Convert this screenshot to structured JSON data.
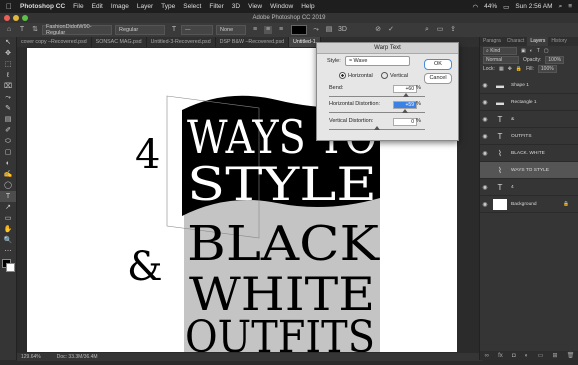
{
  "menubar": {
    "apple": "",
    "app": "Photoshop CC",
    "items": [
      "File",
      "Edit",
      "Image",
      "Layer",
      "Type",
      "Select",
      "Filter",
      "3D",
      "View",
      "Window",
      "Help"
    ],
    "status": {
      "battery": "44%",
      "time": "Sun 2:56 AM"
    }
  },
  "window": {
    "title": "Adobe Photoshop CC 2019"
  },
  "options": {
    "font_family": "FashionDidotW90-Regular",
    "font_style": "Regular",
    "font_size": "—",
    "aa": "None",
    "color": "#000000"
  },
  "tabs": [
    "cover copy –Recovered.psd",
    "SONSAC MAG.psd",
    "Untitled-3-Recovered.psd",
    "DSP B&W –Recovered.psd",
    "Untitled-1"
  ],
  "tools": [
    "↖",
    "✥",
    "⬚",
    "ℓ",
    "⌧",
    "⤳",
    "✎",
    "▤",
    "✐",
    "⬭",
    "▢",
    "◐",
    "✍",
    "◯",
    "T",
    "↗",
    "▭",
    "✋",
    "🔍",
    "⋯"
  ],
  "canvas": {
    "num": "4",
    "amp": "&",
    "line1": "WAYS TO",
    "line2": "STYLE",
    "line3": "BLACK",
    "line4": "WHITE",
    "line5": "OUTFITS"
  },
  "status": {
    "zoom": "129.64%",
    "doc": "Doc: 33.3M/36.4M"
  },
  "panel": {
    "tabs": [
      "Paragra",
      "Charact",
      "Layers",
      "History"
    ],
    "kind": "Kind",
    "mode": "Normal",
    "opacity_label": "Opacity:",
    "opacity": "100%",
    "lock_label": "Lock:",
    "fill_label": "Fill:",
    "fill": "100%",
    "layers": [
      {
        "name": "Shape 1",
        "thumb": "▬",
        "sel": false
      },
      {
        "name": "Rectangle 1",
        "thumb": "▬",
        "sel": false
      },
      {
        "name": "&",
        "thumb": "T",
        "sel": false
      },
      {
        "name": "OUTFITS",
        "thumb": "T",
        "sel": false
      },
      {
        "name": "BLACK. WHITE",
        "thumb": "⌇",
        "sel": false
      },
      {
        "name": "WAYS TO STYLE",
        "thumb": "⌇",
        "sel": true
      },
      {
        "name": "4",
        "thumb": "T",
        "sel": false
      },
      {
        "name": "Background",
        "thumb": "□",
        "sel": false
      }
    ]
  },
  "dialog": {
    "title": "Warp Text",
    "style_label": "Style:",
    "style_value": "Wave",
    "horizontal": "Horizontal",
    "vertical": "Vertical",
    "bend_label": "Bend:",
    "bend_value": "+60",
    "hdist_label": "Horizontal Distortion:",
    "hdist_value": "+59",
    "vdist_label": "Vertical Distortion:",
    "vdist_value": "0",
    "pct": "%",
    "ok": "OK",
    "cancel": "Cancel",
    "bend_level": 0.8,
    "hdist_level": 0.795,
    "vdist_level": 0.5
  }
}
